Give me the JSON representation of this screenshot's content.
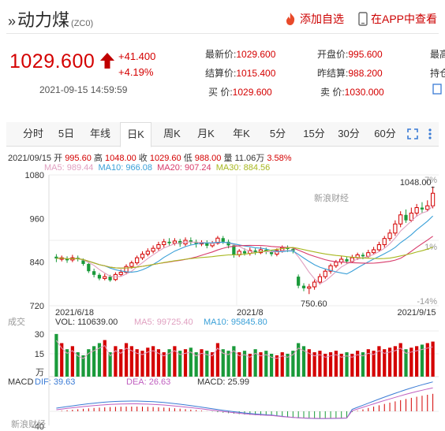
{
  "header": {
    "name": "动力煤",
    "code": "(ZC0)",
    "add_watch": "添加自选",
    "view_app": "在APP中查看"
  },
  "quote": {
    "price": "1029.600",
    "change": "+41.400",
    "change_pct": "+4.19%",
    "timestamp": "2021-09-15 14:59:59",
    "fields": [
      {
        "label": "最新价:",
        "value": "1029.600"
      },
      {
        "label": "开盘价:",
        "value": "995.600"
      },
      {
        "label": "最高",
        "value": ""
      },
      {
        "label": "结算价:",
        "value": "1015.400"
      },
      {
        "label": "昨结算:",
        "value": "988.200"
      },
      {
        "label": "持仓",
        "value": ""
      },
      {
        "label": "买  价:",
        "value": "1029.600"
      },
      {
        "label": "卖  价:",
        "value": "1030.000"
      }
    ],
    "colors": {
      "up": "#d40000",
      "down": "#1a9a3a"
    }
  },
  "tabs": [
    "分时",
    "5日",
    "年线",
    "日K",
    "周K",
    "月K",
    "年K",
    "5分",
    "15分",
    "30分",
    "60分"
  ],
  "active_tab": "日K",
  "chart_info": {
    "date": "2021/09/15",
    "open_label": "开",
    "open": "995.60",
    "high_label": "高",
    "high": "1048.00",
    "close_label": "收",
    "close": "1029.60",
    "low_label": "低",
    "low": "988.00",
    "vol_label": "量",
    "vol": "11.06万",
    "pct": "3.58%",
    "ma5": "MA5: 989.44",
    "ma10": "MA10: 966.08",
    "ma20": "MA20: 907.24",
    "ma30": "MA30: 884.56"
  },
  "price_axis": {
    "ticks": [
      "1080",
      "960",
      "840",
      "720"
    ],
    "pct_ticks": [
      "7%",
      "1%",
      "-14%"
    ]
  },
  "annotations": {
    "high": "1048.00",
    "low": "750.60",
    "watermark": "新浪财经"
  },
  "date_axis": [
    "2021/6/18",
    "2021/8",
    "2021/9/15"
  ],
  "volume": {
    "label": "成交",
    "vol": "VOL: 110639.00",
    "ma5": "MA5: 99725.40",
    "ma10": "MA10: 95845.80",
    "ticks": [
      "30",
      "15",
      "万"
    ]
  },
  "macd": {
    "label": "MACD",
    "dif": "DIF: 39.63",
    "dea": "DEA: 26.63",
    "macd": "MACD: 25.99",
    "ticks": [
      "-40"
    ]
  },
  "footer_watermark": "新浪财经",
  "chart_data": {
    "type": "candlestick",
    "ylim": [
      720,
      1080
    ],
    "x": [
      "2021/6/18",
      "2021/8",
      "2021/9/15"
    ],
    "candles": [
      [
        855,
        850,
        862,
        840
      ],
      [
        848,
        852,
        858,
        842
      ],
      [
        850,
        845,
        856,
        838
      ],
      [
        846,
        852,
        860,
        840
      ],
      [
        852,
        848,
        858,
        842
      ],
      [
        845,
        835,
        850,
        830
      ],
      [
        835,
        815,
        840,
        810
      ],
      [
        815,
        805,
        822,
        798
      ],
      [
        805,
        795,
        810,
        790
      ],
      [
        795,
        800,
        808,
        790
      ],
      [
        800,
        790,
        805,
        786
      ],
      [
        792,
        806,
        812,
        788
      ],
      [
        806,
        812,
        820,
        800
      ],
      [
        812,
        828,
        834,
        806
      ],
      [
        828,
        838,
        844,
        822
      ],
      [
        838,
        852,
        858,
        832
      ],
      [
        852,
        862,
        870,
        846
      ],
      [
        862,
        870,
        878,
        856
      ],
      [
        870,
        878,
        886,
        864
      ],
      [
        878,
        888,
        896,
        872
      ],
      [
        888,
        896,
        904,
        880
      ],
      [
        896,
        892,
        906,
        884
      ],
      [
        892,
        898,
        906,
        886
      ],
      [
        898,
        890,
        904,
        882
      ],
      [
        890,
        900,
        908,
        884
      ],
      [
        900,
        896,
        908,
        888
      ],
      [
        896,
        890,
        902,
        880
      ],
      [
        890,
        894,
        900,
        884
      ],
      [
        894,
        885,
        900,
        878
      ],
      [
        885,
        892,
        898,
        880
      ],
      [
        892,
        906,
        912,
        888
      ],
      [
        906,
        896,
        912,
        890
      ],
      [
        896,
        886,
        902,
        878
      ],
      [
        886,
        860,
        890,
        852
      ],
      [
        860,
        870,
        876,
        854
      ],
      [
        870,
        864,
        878,
        858
      ],
      [
        864,
        872,
        880,
        858
      ],
      [
        872,
        866,
        878,
        860
      ],
      [
        866,
        874,
        882,
        862
      ],
      [
        874,
        868,
        880,
        862
      ],
      [
        868,
        862,
        874,
        856
      ],
      [
        862,
        872,
        878,
        856
      ],
      [
        872,
        880,
        886,
        866
      ],
      [
        880,
        876,
        886,
        868
      ],
      [
        876,
        870,
        880,
        864
      ],
      [
        800,
        775,
        806,
        768
      ],
      [
        775,
        768,
        782,
        760
      ],
      [
        768,
        772,
        780,
        752
      ],
      [
        772,
        785,
        792,
        764
      ],
      [
        785,
        800,
        808,
        778
      ],
      [
        800,
        815,
        822,
        794
      ],
      [
        815,
        830,
        836,
        808
      ],
      [
        830,
        840,
        846,
        824
      ],
      [
        840,
        848,
        856,
        834
      ],
      [
        848,
        842,
        854,
        836
      ],
      [
        842,
        852,
        860,
        838
      ],
      [
        852,
        860,
        866,
        846
      ],
      [
        860,
        856,
        866,
        848
      ],
      [
        856,
        866,
        874,
        850
      ],
      [
        866,
        874,
        882,
        860
      ],
      [
        874,
        888,
        896,
        868
      ],
      [
        888,
        905,
        912,
        880
      ],
      [
        905,
        920,
        930,
        898
      ],
      [
        920,
        945,
        955,
        912
      ],
      [
        945,
        970,
        980,
        936
      ],
      [
        970,
        955,
        985,
        948
      ],
      [
        955,
        975,
        990,
        950
      ],
      [
        975,
        990,
        1000,
        965
      ],
      [
        990,
        985,
        1005,
        975
      ],
      [
        985,
        995,
        1010,
        980
      ],
      [
        995,
        1029.6,
        1048,
        988
      ]
    ],
    "ma_colors": {
      "MA5": "#e0a0c0",
      "MA10": "#3aa0d8",
      "MA20": "#d83a6a",
      "MA30": "#a8b820"
    }
  }
}
